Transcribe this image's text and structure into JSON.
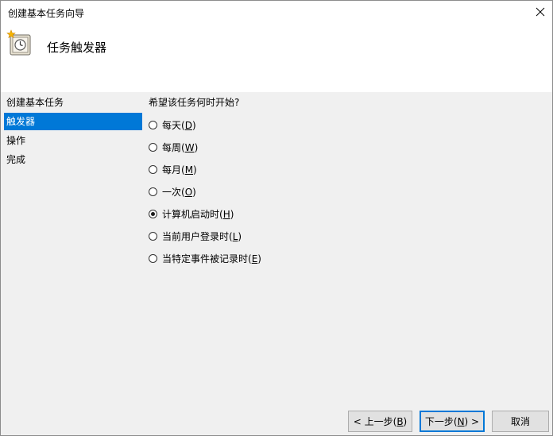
{
  "window": {
    "title": "创建基本任务向导",
    "close_glyph": "✕"
  },
  "header": {
    "heading": "任务触发器",
    "icon": "task-scheduler-clock-icon"
  },
  "sidebar": {
    "items": [
      {
        "label": "创建基本任务",
        "selected": false
      },
      {
        "label": "触发器",
        "selected": true
      },
      {
        "label": "操作",
        "selected": false
      },
      {
        "label": "完成",
        "selected": false
      }
    ]
  },
  "content": {
    "question": "希望该任务何时开始?",
    "options": [
      {
        "text": "每天(",
        "key": "D",
        "suffix": ")",
        "checked": false
      },
      {
        "text": "每周(",
        "key": "W",
        "suffix": ")",
        "checked": false
      },
      {
        "text": "每月(",
        "key": "M",
        "suffix": ")",
        "checked": false
      },
      {
        "text": "一次(",
        "key": "O",
        "suffix": ")",
        "checked": false
      },
      {
        "text": "计算机启动时(",
        "key": "H",
        "suffix": ")",
        "checked": true
      },
      {
        "text": "当前用户登录时(",
        "key": "L",
        "suffix": ")",
        "checked": false
      },
      {
        "text": "当特定事件被记录时(",
        "key": "E",
        "suffix": ")",
        "checked": false
      }
    ]
  },
  "buttons": {
    "back": {
      "text": "< 上一步(",
      "key": "B",
      "suffix": ")"
    },
    "next": {
      "text": "下一步(",
      "key": "N",
      "suffix": ") >"
    },
    "cancel": {
      "text": "取消"
    }
  },
  "colors": {
    "selection": "#0078d7",
    "background": "#f0f0f0",
    "header_background": "#ffffff"
  }
}
